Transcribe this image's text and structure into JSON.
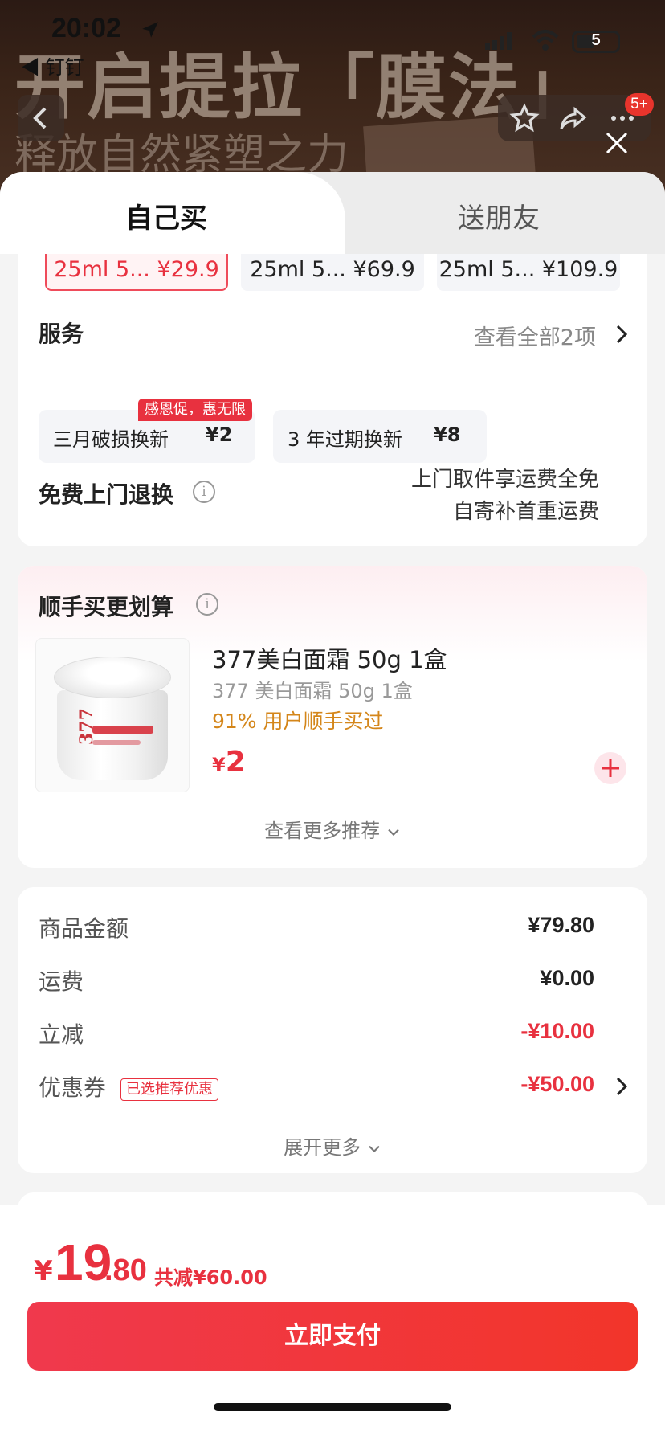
{
  "status": {
    "time": "20:02",
    "back_app": "◀ 钉钉",
    "battery": "5"
  },
  "banner": {
    "headline": "开启提拉「膜法」",
    "subline": "释放自然紧塑之力",
    "badge": "5+"
  },
  "tabs": [
    {
      "label": "自己买"
    },
    {
      "label": "送朋友"
    }
  ],
  "specs": [
    {
      "label": "25ml 5... ¥29.9"
    },
    {
      "label": "25ml 5... ¥69.9"
    },
    {
      "label": "25ml 5... ¥109.9"
    }
  ],
  "service": {
    "title": "服务",
    "view_all": "查看全部2项",
    "promo_tag": "感恩促，惠无限",
    "options": [
      {
        "name": "三月破损换新",
        "price": "¥2"
      },
      {
        "name": "3 年过期换新",
        "price": "¥8"
      }
    ]
  },
  "return": {
    "title": "免费上门退换",
    "line1": "上门取件享运费全免",
    "line2": "自寄补首重运费"
  },
  "addon": {
    "title": "顺手买更划算",
    "product_title": "377美白面霜 50g 1盒",
    "product_sub": "377 美白面霜 50g 1盒",
    "product_pct": "91% 用户顺手买过",
    "price_cur": "¥",
    "price": "2",
    "jar_label": "377",
    "more": "查看更多推荐"
  },
  "summary": {
    "lines": [
      {
        "label": "商品金额",
        "value": "¥79.80"
      },
      {
        "label": "运费",
        "value": "¥0.00"
      },
      {
        "label": "立减",
        "value": "-¥10.00"
      },
      {
        "label": "优惠券",
        "value": "-¥50.00"
      }
    ],
    "coupon_tag": "已选推荐优惠",
    "expand": "展开更多"
  },
  "bottom": {
    "currency": "¥",
    "total_int": "19",
    "total_dec": ".80",
    "saving": "共减¥60.00",
    "pay_label": "立即支付"
  },
  "colors": {
    "accent": "#e8313f",
    "orange": "#d4861a"
  }
}
